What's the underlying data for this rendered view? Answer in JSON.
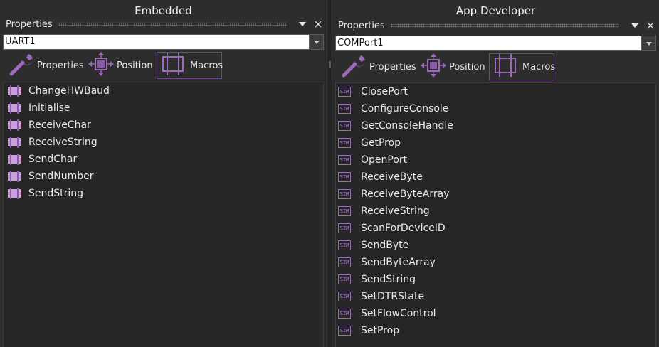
{
  "left_panel": {
    "title": "Embedded",
    "header_label": "Properties",
    "component": "UART1",
    "tabs": [
      {
        "label": "Properties",
        "icon": "wrench-icon"
      },
      {
        "label": "Position",
        "icon": "move-icon"
      },
      {
        "label": "Macros",
        "icon": "macro-icon",
        "active": true
      }
    ],
    "macros": [
      "ChangeHWBaud",
      "Initialise",
      "ReceiveChar",
      "ReceiveString",
      "SendChar",
      "SendNumber",
      "SendString"
    ]
  },
  "right_panel": {
    "title": "App Developer",
    "header_label": "Properties",
    "component": "COMPort1",
    "tabs": [
      {
        "label": "Properties",
        "icon": "wrench-icon"
      },
      {
        "label": "Position",
        "icon": "move-icon"
      },
      {
        "label": "Macros",
        "icon": "macro-icon",
        "active": true
      }
    ],
    "sim_badge": "SIM",
    "macros": [
      "ClosePort",
      "ConfigureConsole",
      "GetConsoleHandle",
      "GetProp",
      "OpenPort",
      "ReceiveByte",
      "ReceiveByteArray",
      "ReceiveString",
      "ScanForDeviceID",
      "SendByte",
      "SendByteArray",
      "SendString",
      "SetDTRState",
      "SetFlowControl",
      "SetProp"
    ]
  },
  "colors": {
    "accent": "#9b6ab8",
    "macro_fill": "#c9a0dc",
    "panel_bg": "#2d2d2d",
    "list_bg": "#262626"
  }
}
